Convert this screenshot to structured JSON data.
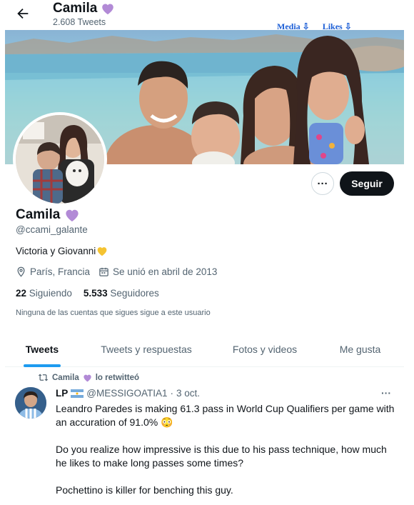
{
  "topbar": {
    "title": "Camila",
    "tweet_count": "2.608 Tweets"
  },
  "overlay_links": {
    "media": "Media ⇩",
    "likes": "Likes ⇩"
  },
  "profile": {
    "name": "Camila",
    "handle": "@ccami_galante",
    "bio": "Victoria y Giovanni",
    "location": "París, Francia",
    "joined": "Se unió en abril de 2013",
    "following_count": "22",
    "following_label": "Siguiendo",
    "followers_count": "5.533",
    "followers_label": "Seguidores",
    "notice": "Ninguna de las cuentas que sigues sigue a este usuario"
  },
  "actions": {
    "more_label": "···",
    "follow_label": "Seguir"
  },
  "tabs": [
    {
      "label": "Tweets"
    },
    {
      "label": "Tweets y respuestas"
    },
    {
      "label": "Fotos y videos"
    },
    {
      "label": "Me gusta"
    }
  ],
  "tweet": {
    "retweeter": "Camila",
    "retweet_suffix": "lo retwitteó",
    "author": "LP",
    "handle": "@MESSIGOATIA1",
    "separator": "·",
    "date": "3 oct.",
    "more_label": "···",
    "paragraph1": "Leandro Paredes is making 61.3 pass in World Cup Qualifiers per game with an accuration of 91.0% 😳",
    "paragraph2": "Do you realize how impressive is this due to his pass technique, how much he likes to make long passes some times?",
    "paragraph3": "Pochettino is killer for benching this guy."
  },
  "colors": {
    "accent": "#1d9bf0",
    "heart_purple": "#b28ad6",
    "heart_yellow": "#f5c331",
    "follow_bg": "#0f1419",
    "link_blue": "#1d5fd6"
  },
  "icons": {
    "back": "arrow-left-icon",
    "location": "location-pin-icon",
    "calendar": "calendar-icon",
    "retweet": "retweet-icon"
  }
}
